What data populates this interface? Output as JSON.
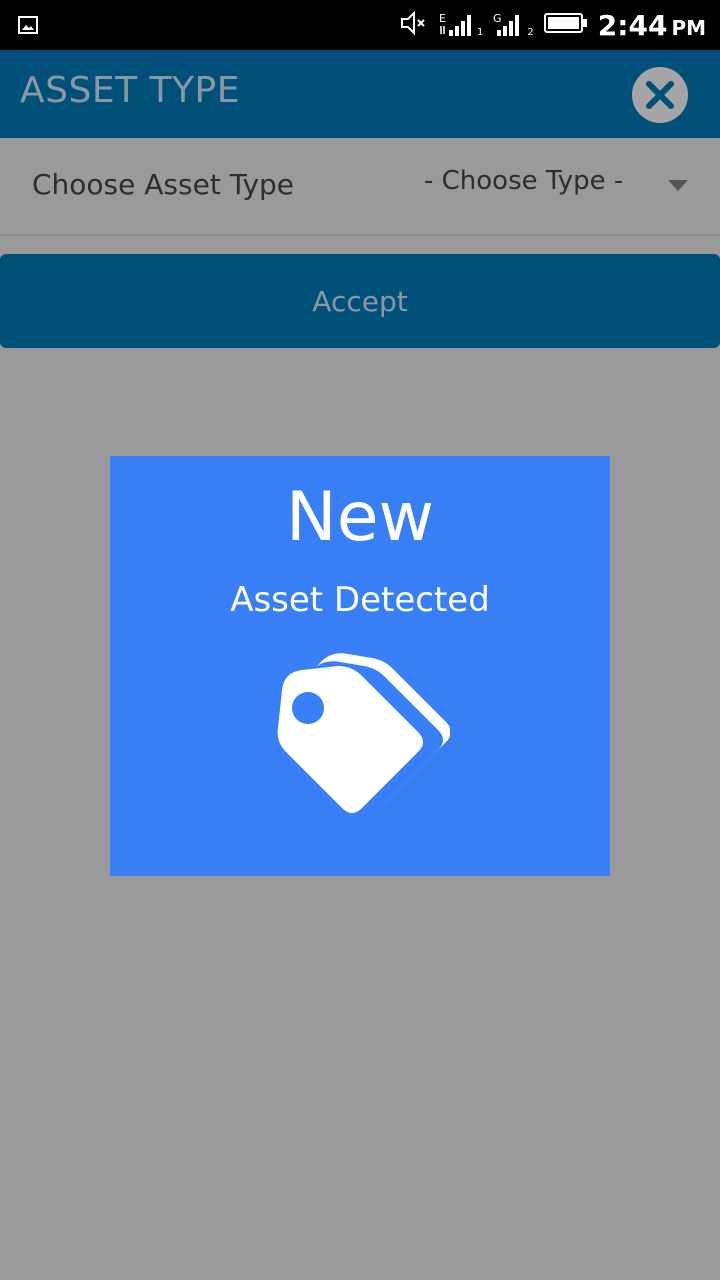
{
  "status_bar": {
    "time": "2:44",
    "ampm": "PM",
    "sim1_letter": "E",
    "sim1_index": "1",
    "sim2_letter": "G",
    "sim2_index": "2"
  },
  "header": {
    "title": "ASSET TYPE",
    "close_icon": "close-icon"
  },
  "asset_type": {
    "label": "Choose Asset Type",
    "select_value": "- Choose Type -"
  },
  "accept_button": {
    "label": "Accept"
  },
  "dialog": {
    "title": "New",
    "subtitle": "Asset Detected",
    "icon": "tags-icon"
  },
  "colors": {
    "status_bar": "#000000",
    "header_bg": "#00507a",
    "overlay_bg": "#9a9a9a",
    "dialog_bg": "#387ef5"
  }
}
